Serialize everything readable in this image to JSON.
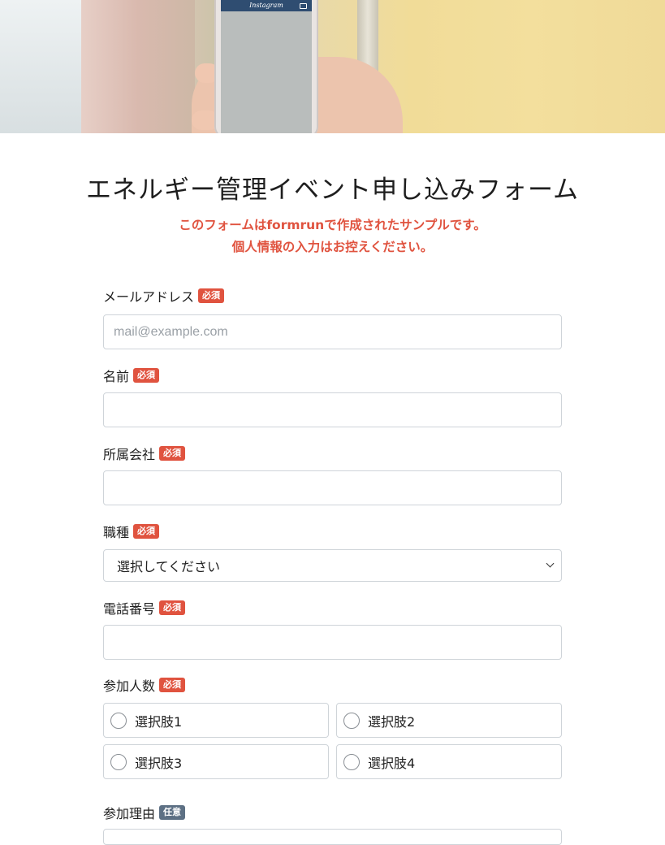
{
  "hero": {
    "phone_app_title": "Instagram"
  },
  "form": {
    "title": "エネルギー管理イベント申し込みフォーム",
    "notice_line1": "このフォームはformrunで作成されたサンプルです。",
    "notice_line2": "個人情報の入力はお控えください。",
    "required_badge": "必須",
    "optional_badge": "任意",
    "fields": {
      "email": {
        "label": "メールアドレス",
        "placeholder": "mail@example.com",
        "value": ""
      },
      "name": {
        "label": "名前",
        "value": ""
      },
      "company": {
        "label": "所属会社",
        "value": ""
      },
      "job": {
        "label": "職種",
        "selected": "選択してください"
      },
      "phone": {
        "label": "電話番号",
        "value": ""
      },
      "participants": {
        "label": "参加人数",
        "options": [
          "選択肢1",
          "選択肢2",
          "選択肢3",
          "選択肢4"
        ]
      },
      "reason": {
        "label": "参加理由"
      }
    }
  },
  "colors": {
    "accent": "#e0533f",
    "optional_badge": "#5d7084",
    "border": "#cfd4d9"
  }
}
